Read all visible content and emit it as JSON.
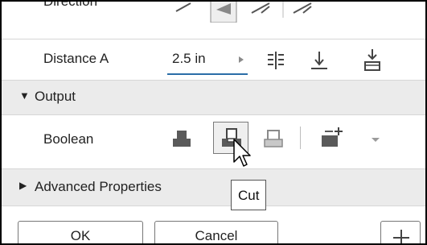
{
  "direction": {
    "label": "Direction"
  },
  "distance": {
    "label": "Distance A",
    "value": "2.5 in"
  },
  "output": {
    "header": "Output",
    "arrow": "▼"
  },
  "boolean": {
    "label": "Boolean"
  },
  "advanced": {
    "header": "Advanced Properties",
    "arrow": "▶"
  },
  "tooltip": {
    "text": "Cut"
  },
  "footer": {
    "ok": "OK",
    "cancel": "Cancel"
  },
  "colors": {
    "header_bg": "#ebebeb",
    "icon_dark": "#5a5a5a",
    "input_underline": "#2b6ea8"
  },
  "icons": [
    "direction-icons",
    "stepper-arrow-icon",
    "measure-icon",
    "extend-down-icon",
    "to-face-icon",
    "join-icon",
    "cut-icon",
    "intersect-icon",
    "new-solid-icon",
    "dropdown-icon",
    "cursor-icon"
  ]
}
